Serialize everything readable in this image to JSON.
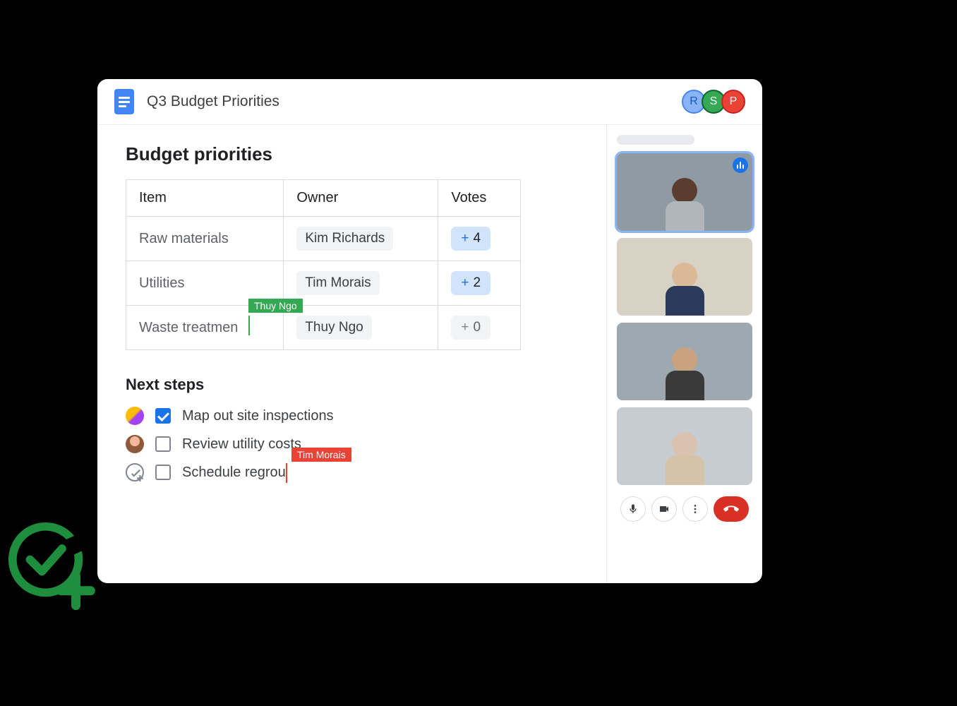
{
  "header": {
    "title": "Q3 Budget Priorities",
    "collaborators": [
      {
        "initial": "R",
        "color": "blue"
      },
      {
        "initial": "S",
        "color": "green"
      },
      {
        "initial": "P",
        "color": "red"
      }
    ]
  },
  "document": {
    "section_heading": "Budget priorities",
    "table": {
      "columns": [
        "Item",
        "Owner",
        "Votes"
      ],
      "rows": [
        {
          "item": "Raw materials",
          "owner": "Kim Richards",
          "votes": 4,
          "vote_style": "blue"
        },
        {
          "item": "Utilities",
          "owner": "Tim Morais",
          "votes": 2,
          "vote_style": "blue"
        },
        {
          "item": "Waste treatmen",
          "owner": "Thuy Ngo",
          "votes": 0,
          "vote_style": "gray"
        }
      ]
    },
    "cursors": {
      "green_label": "Thuy Ngo",
      "red_label": "Tim Morais"
    },
    "next_steps": {
      "heading": "Next steps",
      "tasks": [
        {
          "text": "Map out site inspections",
          "checked": true,
          "assignee": "duo"
        },
        {
          "text": "Review utility costs",
          "checked": false,
          "assignee": "single1"
        },
        {
          "text": "Schedule regrou",
          "checked": false,
          "assignee": "add"
        }
      ]
    }
  },
  "video": {
    "participants": [
      {
        "bg": "#8f9ba3",
        "head": "#5a3d2e",
        "body": "#b0b6ba",
        "active": true,
        "speaking": true
      },
      {
        "bg": "#d8d2c4",
        "head": "#d9b998",
        "body": "#2b3a5a",
        "active": false,
        "speaking": false
      },
      {
        "bg": "#9da8b0",
        "head": "#c9a27e",
        "body": "#3a3a3a",
        "active": false,
        "speaking": false
      },
      {
        "bg": "#c7ccd1",
        "head": "#d9c2b0",
        "body": "#d4c3a8",
        "active": false,
        "speaking": false
      }
    ]
  }
}
